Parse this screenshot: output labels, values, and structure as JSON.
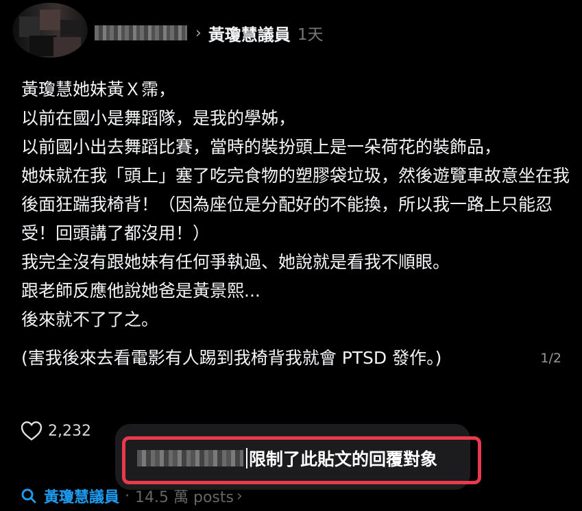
{
  "header": {
    "page_name": "黃瓊慧議員",
    "time": "1天",
    "chevron": "›"
  },
  "post": {
    "lines": [
      "黃瓊慧她妹黃Ｘ霈，",
      "以前在國小是舞蹈隊，是我的學姊，",
      "以前國小出去舞蹈比賽，當時的裝扮頭上是一朵荷花的裝飾品，",
      "她妹就在我「頭上」塞了吃完食物的塑膠袋垃圾，然後遊覽車故意坐在我後面狂踹我椅背！（因為座位是分配好的不能換，所以我一路上只能忍受！回頭講了都沒用！）",
      "我完全沒有跟她妹有任何爭執過、她說就是看我不順眼。",
      "跟老師反應他說她爸是黃景熙...",
      "後來就不了了之。"
    ],
    "last_line": "(害我後來去看電影有人踢到我椅背我就會 PTSD 發作。)",
    "page_indicator": "1/2"
  },
  "actions": {
    "like_count": "2,232",
    "like_icon": "heart-icon"
  },
  "toast": {
    "message": "限制了此貼文的回覆對象"
  },
  "footer": {
    "tag": "黃瓊慧議員",
    "separator": "·",
    "meta": "14.5 萬 posts",
    "chevron": "›",
    "icon": "search-icon"
  },
  "colors": {
    "background": "#000000",
    "text": "#f3f5f7",
    "link": "#1d9bf0",
    "highlight_border": "#e8394d",
    "toast_bg": "#1c1c1e"
  }
}
